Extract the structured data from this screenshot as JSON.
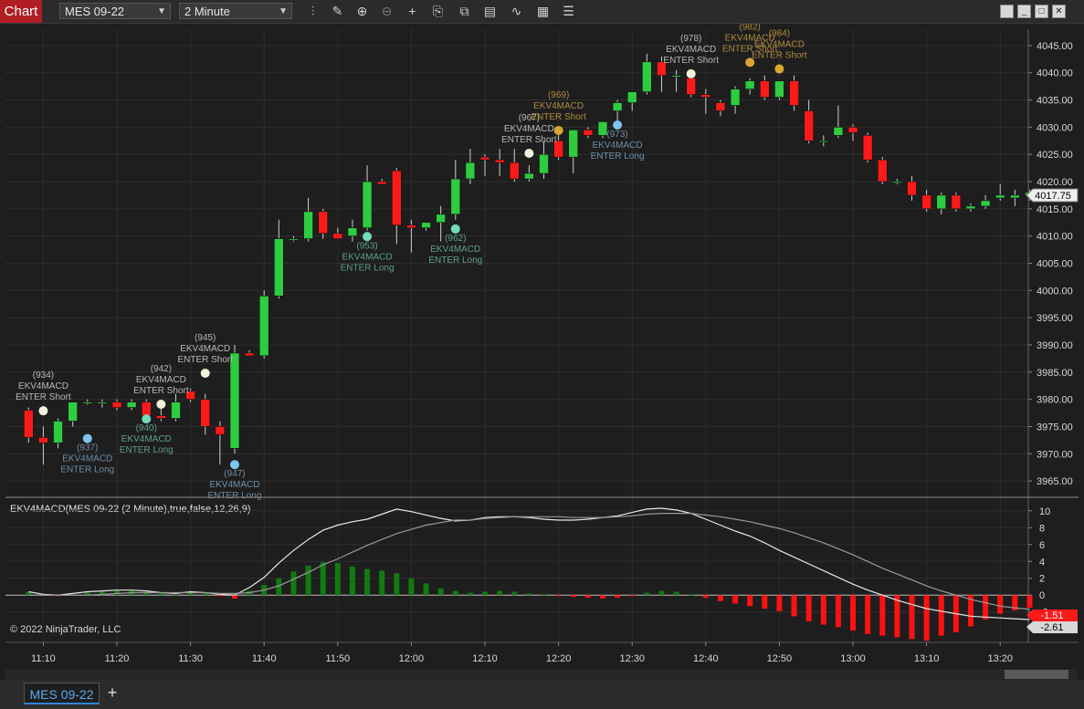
{
  "toolbar": {
    "tab_label": "Chart",
    "instrument": "MES 09-22",
    "interval": "2 Minute",
    "icons": [
      "bar-type-icon",
      "draw-pencil-icon",
      "zoom-in-icon",
      "zoom-out-icon",
      "crosshair-icon",
      "properties-icon",
      "templates-icon",
      "strategies-icon",
      "indicators-icon",
      "data-box-icon",
      "chart-trader-icon"
    ],
    "window_buttons": [
      "restore-icon",
      "minimize-icon",
      "maximize-icon",
      "close-icon"
    ]
  },
  "price_axis": {
    "ticks": [
      "4045.00",
      "4040.00",
      "4035.00",
      "4030.00",
      "4025.00",
      "4020.00",
      "4015.00",
      "4010.00",
      "4005.00",
      "4000.00",
      "3995.00",
      "3990.00",
      "3985.00",
      "3980.00",
      "3975.00",
      "3970.00",
      "3965.00"
    ],
    "last_price": "4017.75"
  },
  "indicator": {
    "label": "EKV4MACD(MES 09-22 (2 Minute),true,false,12,26,9)",
    "ticks": [
      "10",
      "8",
      "6",
      "4",
      "2",
      "0",
      "-2"
    ],
    "value_hist": "-1.51",
    "value_signal": "-2.61"
  },
  "copyright": "© 2022 NinjaTrader, LLC",
  "time_axis": [
    "11:10",
    "11:20",
    "11:30",
    "11:40",
    "11:50",
    "12:00",
    "12:10",
    "12:20",
    "12:30",
    "12:40",
    "12:50",
    "13:00",
    "13:10",
    "13:20"
  ],
  "signals": [
    {
      "id": "(934)",
      "name": "EKV4MACD",
      "action": "ENTER Short",
      "i": 1,
      "price": 3977.9,
      "color": "#f4f1dc",
      "text": "#b8b8b8"
    },
    {
      "id": "(937)",
      "name": "EKV4MACD",
      "action": "ENTER Long",
      "i": 4,
      "price": 3972.8,
      "color": "#7ec4ee",
      "text": "#6c8eaa"
    },
    {
      "id": "(940)",
      "name": "EKV4MACD",
      "action": "ENTER Long",
      "i": 8,
      "price": 3976.4,
      "color": "#72dcbc",
      "text": "#5e9e8a"
    },
    {
      "id": "(942)",
      "name": "EKV4MACD",
      "action": "ENTER Short",
      "i": 9,
      "price": 3979.1,
      "color": "#f4f1dc",
      "text": "#b8b8b8"
    },
    {
      "id": "(945)",
      "name": "EKV4MACD",
      "action": "ENTER Short",
      "i": 12,
      "price": 3984.8,
      "color": "#f4f1dc",
      "text": "#b8b8b8"
    },
    {
      "id": "(947)",
      "name": "EKV4MACD",
      "action": "ENTER Long",
      "i": 14,
      "price": 3968.0,
      "color": "#7ec4ee",
      "text": "#6c8eaa"
    },
    {
      "id": "(953)",
      "name": "EKV4MACD",
      "action": "ENTER Long",
      "i": 23,
      "price": 4009.9,
      "color": "#72dcbc",
      "text": "#5e9e8a"
    },
    {
      "id": "(962)",
      "name": "EKV4MACD",
      "action": "ENTER Long",
      "i": 29,
      "price": 4011.3,
      "color": "#72dcbc",
      "text": "#5e9e8a"
    },
    {
      "id": "(967)",
      "name": "EKV4MACD",
      "action": "ENTER Short",
      "i": 34,
      "price": 4025.2,
      "color": "#f4f1dc",
      "text": "#b8b8b8"
    },
    {
      "id": "(969)",
      "name": "EKV4MACD",
      "action": "ENTER Short",
      "i": 36,
      "price": 4029.4,
      "color": "#d9a630",
      "text": "#b08a3c"
    },
    {
      "id": "(973)",
      "name": "EKV4MACD",
      "action": "ENTER Long",
      "i": 40,
      "price": 4030.4,
      "color": "#7ec4ee",
      "text": "#6c8eaa"
    },
    {
      "id": "(978)",
      "name": "EKV4MACD",
      "action": "ENTER Short",
      "i": 45,
      "price": 4039.8,
      "color": "#f4f1dc",
      "text": "#b8b8b8"
    },
    {
      "id": "(982)",
      "name": "EKV4MACD",
      "action": "ENTER Short",
      "i": 49,
      "price": 4041.9,
      "color": "#d9a630",
      "text": "#b08a3c"
    },
    {
      "id": "(984)",
      "name": "EKV4MACD",
      "action": "ENTER Short",
      "i": 51,
      "price": 4040.7,
      "color": "#d9a630",
      "text": "#b08a3c"
    }
  ],
  "chart_data": {
    "type": "candlestick",
    "interval_minutes": 2,
    "start_time": "11:08",
    "ohlc": [
      [
        3978.0,
        3978.5,
        3972.0,
        3973.0
      ],
      [
        3973.0,
        3975.0,
        3968.0,
        3972.0
      ],
      [
        3972.0,
        3976.5,
        3971.0,
        3976.0
      ],
      [
        3976.0,
        3979.5,
        3975.0,
        3979.5
      ],
      [
        3979.5,
        3980.0,
        3979.0,
        3979.5
      ],
      [
        3979.5,
        3980.0,
        3978.5,
        3979.5
      ],
      [
        3979.5,
        3980.0,
        3978.0,
        3978.5
      ],
      [
        3978.5,
        3980.0,
        3978.0,
        3979.5
      ],
      [
        3979.5,
        3980.0,
        3976.0,
        3977.0
      ],
      [
        3977.0,
        3979.0,
        3976.0,
        3976.5
      ],
      [
        3976.5,
        3981.0,
        3976.0,
        3979.5
      ],
      [
        3981.5,
        3982.0,
        3979.5,
        3980.0
      ],
      [
        3980.0,
        3981.0,
        3973.5,
        3975.0
      ],
      [
        3975.0,
        3976.0,
        3968.0,
        3973.5
      ],
      [
        3971.0,
        3990.0,
        3970.0,
        3988.5
      ],
      [
        3988.5,
        3989.0,
        3988.0,
        3988.0
      ],
      [
        3988.0,
        4000.0,
        3987.5,
        3999.0
      ],
      [
        3999.0,
        4013.0,
        3998.5,
        4009.5
      ],
      [
        4009.5,
        4010.0,
        4009.0,
        4009.5
      ],
      [
        4009.5,
        4017.0,
        4009.0,
        4014.5
      ],
      [
        4014.5,
        4015.0,
        4009.5,
        4010.5
      ],
      [
        4010.5,
        4011.5,
        4009.5,
        4009.5
      ],
      [
        4010.0,
        4013.0,
        4009.0,
        4011.5
      ],
      [
        4011.5,
        4023.0,
        4011.0,
        4020.0
      ],
      [
        4020.0,
        4020.5,
        4019.5,
        4019.5
      ],
      [
        4022.0,
        4022.5,
        4008.5,
        4012.0
      ],
      [
        4012.0,
        4013.0,
        4007.0,
        4011.5
      ],
      [
        4011.5,
        4012.5,
        4011.0,
        4012.5
      ],
      [
        4012.5,
        4015.5,
        4009.0,
        4014.0
      ],
      [
        4014.0,
        4024.0,
        4013.0,
        4020.5
      ],
      [
        4020.5,
        4026.0,
        4019.5,
        4023.5
      ],
      [
        4024.5,
        4025.0,
        4021.0,
        4024.0
      ],
      [
        4024.0,
        4026.0,
        4021.0,
        4023.5
      ],
      [
        4023.5,
        4026.0,
        4020.0,
        4020.5
      ],
      [
        4020.5,
        4023.0,
        4020.0,
        4021.5
      ],
      [
        4021.5,
        4027.5,
        4020.5,
        4025.0
      ],
      [
        4027.5,
        4030.0,
        4024.0,
        4024.5
      ],
      [
        4024.5,
        4029.5,
        4021.5,
        4029.5
      ],
      [
        4029.5,
        4030.0,
        4028.0,
        4028.5
      ],
      [
        4028.5,
        4031.0,
        4028.0,
        4031.0
      ],
      [
        4033.0,
        4035.0,
        4030.0,
        4034.5
      ],
      [
        4034.5,
        4036.5,
        4033.0,
        4036.5
      ],
      [
        4036.5,
        4043.5,
        4036.0,
        4042.0
      ],
      [
        4042.0,
        4043.0,
        4036.5,
        4039.5
      ],
      [
        4039.5,
        4040.5,
        4036.5,
        4039.5
      ],
      [
        4039.0,
        4040.0,
        4035.5,
        4036.0
      ],
      [
        4036.0,
        4037.0,
        4032.5,
        4035.5
      ],
      [
        4034.5,
        4035.0,
        4032.0,
        4033.0
      ],
      [
        4034.0,
        4037.5,
        4032.5,
        4037.0
      ],
      [
        4037.0,
        4039.0,
        4036.0,
        4038.5
      ],
      [
        4038.5,
        4039.5,
        4035.0,
        4035.5
      ],
      [
        4035.5,
        4038.0,
        4035.0,
        4038.5
      ],
      [
        4038.5,
        4039.5,
        4033.0,
        4034.0
      ],
      [
        4033.0,
        4035.0,
        4027.0,
        4027.5
      ],
      [
        4027.5,
        4028.5,
        4026.5,
        4027.5
      ],
      [
        4028.5,
        4034.0,
        4028.0,
        4030.0
      ],
      [
        4030.0,
        4030.5,
        4027.5,
        4029.0
      ],
      [
        4028.5,
        4029.0,
        4023.5,
        4024.0
      ],
      [
        4024.0,
        4024.5,
        4019.5,
        4020.0
      ],
      [
        4020.0,
        4020.5,
        4019.5,
        4020.0
      ],
      [
        4020.0,
        4021.0,
        4016.5,
        4017.5
      ],
      [
        4017.5,
        4018.5,
        4014.5,
        4015.0
      ],
      [
        4015.0,
        4018.0,
        4014.0,
        4017.5
      ],
      [
        4017.5,
        4018.0,
        4014.5,
        4015.0
      ],
      [
        4015.0,
        4016.0,
        4014.5,
        4015.5
      ],
      [
        4015.5,
        4017.5,
        4015.0,
        4016.5
      ],
      [
        4017.0,
        4019.5,
        4016.5,
        4017.5
      ],
      [
        4017.0,
        4018.5,
        4015.5,
        4017.5
      ],
      [
        4017.5,
        4018.5,
        4016.5,
        4018.0
      ]
    ],
    "histogram": [
      0.4,
      0.1,
      -0.1,
      0.1,
      0.3,
      0.4,
      0.5,
      0.5,
      0.4,
      0.2,
      0.0,
      0.3,
      0.2,
      -0.1,
      -0.4,
      0.5,
      1.2,
      2.0,
      2.8,
      3.5,
      3.9,
      3.8,
      3.4,
      3.1,
      2.9,
      2.6,
      2.0,
      1.4,
      0.8,
      0.5,
      0.3,
      0.4,
      0.5,
      0.4,
      0.2,
      0.1,
      -0.1,
      -0.2,
      -0.3,
      -0.4,
      -0.3,
      -0.1,
      0.3,
      0.5,
      0.4,
      0.1,
      -0.3,
      -0.7,
      -1.0,
      -1.3,
      -1.6,
      -1.9,
      -2.5,
      -3.1,
      -3.5,
      -3.8,
      -4.2,
      -4.6,
      -4.8,
      -5.0,
      -5.2,
      -5.4,
      -4.8,
      -4.4,
      -3.7,
      -2.9,
      -2.2,
      -1.8,
      -1.51
    ],
    "macd_line": [
      0.4,
      0.1,
      0.0,
      0.2,
      0.4,
      0.5,
      0.6,
      0.6,
      0.5,
      0.3,
      0.2,
      0.4,
      0.3,
      0.1,
      0.0,
      0.9,
      2.1,
      3.8,
      5.3,
      6.6,
      7.7,
      8.3,
      8.7,
      9.0,
      9.6,
      10.2,
      9.9,
      9.5,
      9.1,
      8.8,
      8.9,
      9.2,
      9.3,
      9.3,
      9.2,
      9.0,
      8.9,
      8.9,
      9.0,
      9.2,
      9.4,
      9.8,
      10.2,
      10.3,
      10.1,
      9.7,
      9.0,
      8.3,
      7.6,
      7.0,
      6.2,
      5.3,
      4.5,
      3.7,
      2.9,
      2.1,
      1.3,
      0.6,
      0.0,
      -0.6,
      -1.1,
      -1.6,
      -1.9,
      -2.2,
      -2.5,
      -2.6,
      -2.7,
      -2.8,
      -2.9
    ],
    "signal_line": [
      0.0,
      0.0,
      0.0,
      0.0,
      0.0,
      0.1,
      0.2,
      0.3,
      0.3,
      0.3,
      0.3,
      0.3,
      0.3,
      0.2,
      0.2,
      0.3,
      0.6,
      1.1,
      1.9,
      2.7,
      3.6,
      4.3,
      5.1,
      5.9,
      6.6,
      7.3,
      7.8,
      8.3,
      8.6,
      8.9,
      8.9,
      9.1,
      9.2,
      9.3,
      9.3,
      9.3,
      9.3,
      9.2,
      9.2,
      9.2,
      9.3,
      9.4,
      9.6,
      9.7,
      9.7,
      9.7,
      9.5,
      9.3,
      9.0,
      8.7,
      8.3,
      7.9,
      7.4,
      6.8,
      6.2,
      5.5,
      4.8,
      4.0,
      3.2,
      2.5,
      1.8,
      1.1,
      0.5,
      0.0,
      -0.5,
      -0.9,
      -1.3,
      -1.5,
      -1.7
    ],
    "ylim": [
      3962,
      4048
    ],
    "indicator_ylim": [
      -5.6,
      11.6
    ]
  },
  "colors": {
    "up": "#2ecc40",
    "down": "#ff1a1a",
    "hist_pos": "#117a11",
    "hist_neg": "#ff1111",
    "grid": "#2e2e2e",
    "macd": "#e8e8e8",
    "signal": "#9a9a9a",
    "last_price_bg": "#f0f0f0",
    "neg_tag": "#ff1a1a"
  }
}
